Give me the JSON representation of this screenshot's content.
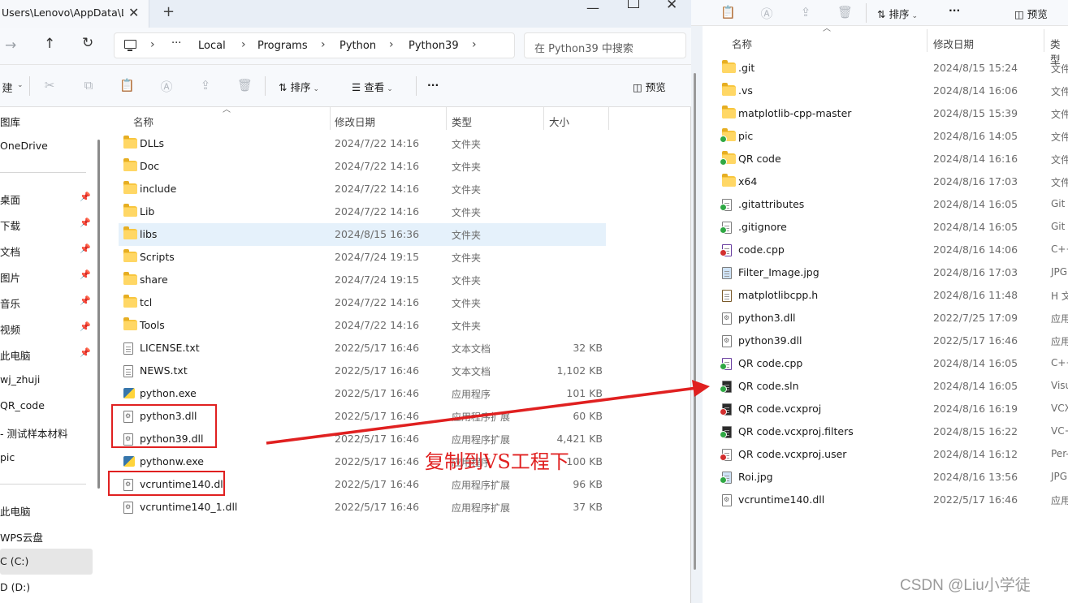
{
  "left_window": {
    "tab_title": "Users\\Lenovo\\AppData\\Loc",
    "breadcrumbs": [
      "Local",
      "Programs",
      "Python",
      "Python39"
    ],
    "search_placeholder": "在 Python39 中搜索",
    "toolbar": {
      "sort_label": "排序",
      "view_label": "查看",
      "preview_label": "预览",
      "more_label": "···"
    },
    "sidebar": [
      {
        "label": "图库",
        "pinned": false
      },
      {
        "label": "OneDrive",
        "pinned": false
      },
      {
        "label": "桌面",
        "pinned": true
      },
      {
        "label": "下载",
        "pinned": true
      },
      {
        "label": "文档",
        "pinned": true
      },
      {
        "label": "图片",
        "pinned": true
      },
      {
        "label": "音乐",
        "pinned": true
      },
      {
        "label": "视频",
        "pinned": true
      },
      {
        "label": "此电脑",
        "pinned": true
      },
      {
        "label": "wj_zhuji",
        "pinned": false
      },
      {
        "label": "QR_code",
        "pinned": false
      },
      {
        "label": "- 测试样本材料",
        "pinned": false
      },
      {
        "label": "pic",
        "pinned": false
      },
      {
        "label": "此电脑",
        "pinned": false
      },
      {
        "label": "WPS云盘",
        "pinned": false
      },
      {
        "label": "C (C:)",
        "pinned": false
      },
      {
        "label": "D (D:)",
        "pinned": false
      }
    ],
    "columns": {
      "name": "名称",
      "date": "修改日期",
      "type": "类型",
      "size": "大小"
    },
    "files": [
      {
        "name": "DLLs",
        "date": "2024/7/22 14:16",
        "type": "文件夹",
        "size": "",
        "icon": "folder-icon"
      },
      {
        "name": "Doc",
        "date": "2024/7/22 14:16",
        "type": "文件夹",
        "size": "",
        "icon": "folder-icon"
      },
      {
        "name": "include",
        "date": "2024/7/22 14:16",
        "type": "文件夹",
        "size": "",
        "icon": "folder-icon"
      },
      {
        "name": "Lib",
        "date": "2024/7/22 14:16",
        "type": "文件夹",
        "size": "",
        "icon": "folder-icon"
      },
      {
        "name": "libs",
        "date": "2024/8/15 16:36",
        "type": "文件夹",
        "size": "",
        "icon": "folder-icon",
        "selected": true
      },
      {
        "name": "Scripts",
        "date": "2024/7/24 19:15",
        "type": "文件夹",
        "size": "",
        "icon": "folder-icon"
      },
      {
        "name": "share",
        "date": "2024/7/24 19:15",
        "type": "文件夹",
        "size": "",
        "icon": "folder-icon"
      },
      {
        "name": "tcl",
        "date": "2024/7/22 14:16",
        "type": "文件夹",
        "size": "",
        "icon": "folder-icon"
      },
      {
        "name": "Tools",
        "date": "2024/7/22 14:16",
        "type": "文件夹",
        "size": "",
        "icon": "folder-icon"
      },
      {
        "name": "LICENSE.txt",
        "date": "2022/5/17 16:46",
        "type": "文本文档",
        "size": "32 KB",
        "icon": "text-file-icon"
      },
      {
        "name": "NEWS.txt",
        "date": "2022/5/17 16:46",
        "type": "文本文档",
        "size": "1,102 KB",
        "icon": "text-file-icon"
      },
      {
        "name": "python.exe",
        "date": "2022/5/17 16:46",
        "type": "应用程序",
        "size": "101 KB",
        "icon": "python-exe-icon"
      },
      {
        "name": "python3.dll",
        "date": "2022/5/17 16:46",
        "type": "应用程序扩展",
        "size": "60 KB",
        "icon": "dll-file-icon"
      },
      {
        "name": "python39.dll",
        "date": "2022/5/17 16:46",
        "type": "应用程序扩展",
        "size": "4,421 KB",
        "icon": "dll-file-icon"
      },
      {
        "name": "pythonw.exe",
        "date": "2022/5/17 16:46",
        "type": "应用程序",
        "size": "100 KB",
        "icon": "python-exe-icon"
      },
      {
        "name": "vcruntime140.dll",
        "date": "2022/5/17 16:46",
        "type": "应用程序扩展",
        "size": "96 KB",
        "icon": "dll-file-icon"
      },
      {
        "name": "vcruntime140_1.dll",
        "date": "2022/5/17 16:46",
        "type": "应用程序扩展",
        "size": "37 KB",
        "icon": "dll-file-icon"
      }
    ]
  },
  "annotation": {
    "text": "复制到VS工程下",
    "color": "#e02020"
  },
  "right_window": {
    "toolbar": {
      "sort_label": "排序",
      "more_label": "···",
      "preview_label": "预览"
    },
    "columns": {
      "name": "名称",
      "date": "修改日期",
      "type": "类型"
    },
    "files": [
      {
        "name": ".git",
        "date": "2024/8/15 15:24",
        "type": "文件",
        "icon": "folder-icon"
      },
      {
        "name": ".vs",
        "date": "2024/8/14 16:06",
        "type": "文件",
        "icon": "folder-icon"
      },
      {
        "name": "matplotlib-cpp-master",
        "date": "2024/8/15 15:39",
        "type": "文件",
        "icon": "folder-icon"
      },
      {
        "name": "pic",
        "date": "2024/8/16 14:05",
        "type": "文件",
        "icon": "folder-icon",
        "badge": "ok"
      },
      {
        "name": "QR code",
        "date": "2024/8/14 16:16",
        "type": "文件",
        "icon": "folder-icon",
        "badge": "ok"
      },
      {
        "name": "x64",
        "date": "2024/8/16 17:03",
        "type": "文件",
        "icon": "folder-icon"
      },
      {
        "name": ".gitattributes",
        "date": "2024/8/14 16:05",
        "type": "Git A",
        "icon": "text-file-icon",
        "badge": "ok"
      },
      {
        "name": ".gitignore",
        "date": "2024/8/14 16:05",
        "type": "Git I",
        "icon": "text-file-icon",
        "badge": "ok"
      },
      {
        "name": "code.cpp",
        "date": "2024/8/16 14:06",
        "type": "C++",
        "icon": "cpp-file-icon",
        "badge": "err"
      },
      {
        "name": "Filter_Image.jpg",
        "date": "2024/8/16 17:03",
        "type": "JPG",
        "icon": "image-file-icon"
      },
      {
        "name": "matplotlibcpp.h",
        "date": "2024/8/16 11:48",
        "type": "H 文",
        "icon": "header-file-icon"
      },
      {
        "name": "python3.dll",
        "date": "2022/7/25 17:09",
        "type": "应用",
        "icon": "dll-file-icon"
      },
      {
        "name": "python39.dll",
        "date": "2022/5/17 16:46",
        "type": "应用",
        "icon": "dll-file-icon"
      },
      {
        "name": "QR code.cpp",
        "date": "2024/8/14 16:05",
        "type": "C++",
        "icon": "cpp-file-icon",
        "badge": "ok"
      },
      {
        "name": "QR code.sln",
        "date": "2024/8/14 16:05",
        "type": "Visu",
        "icon": "sln-file-icon",
        "badge": "ok"
      },
      {
        "name": "QR code.vcxproj",
        "date": "2024/8/16 16:19",
        "type": "VCX",
        "icon": "vcxproj-file-icon",
        "badge": "err"
      },
      {
        "name": "QR code.vcxproj.filters",
        "date": "2024/8/15 16:22",
        "type": "VC+",
        "icon": "vcxproj-file-icon",
        "badge": "ok"
      },
      {
        "name": "QR code.vcxproj.user",
        "date": "2024/8/14 16:12",
        "type": "Per-",
        "icon": "text-file-icon",
        "badge": "err"
      },
      {
        "name": "Roi.jpg",
        "date": "2024/8/16 13:56",
        "type": "JPG",
        "icon": "image-file-icon",
        "badge": "ok"
      },
      {
        "name": "vcruntime140.dll",
        "date": "2022/5/17 16:46",
        "type": "应用",
        "icon": "dll-file-icon"
      }
    ]
  },
  "watermark": "CSDN @Liu小学徒"
}
